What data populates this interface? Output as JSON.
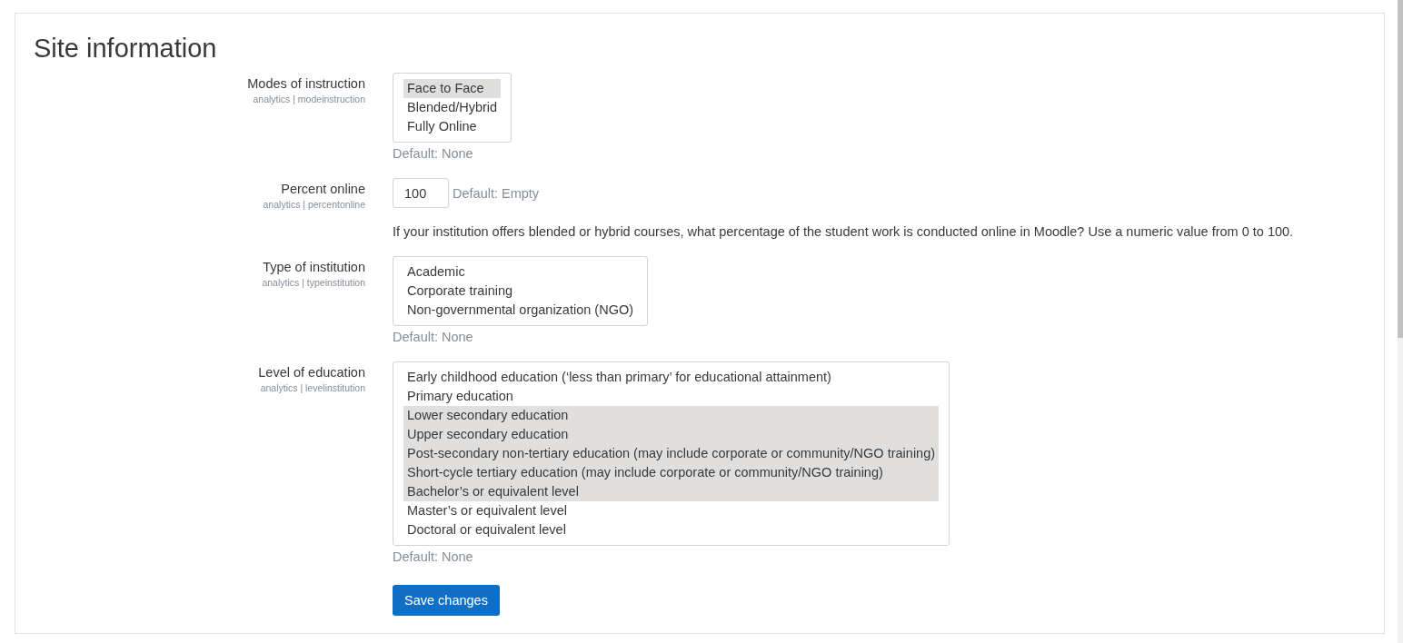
{
  "page": {
    "title": "Site information"
  },
  "settings": [
    {
      "kind": "multiselect",
      "label": "Modes of instruction",
      "key": "analytics | modeinstruction",
      "options": [
        {
          "label": "Face to Face",
          "selected": true
        },
        {
          "label": "Blended/Hybrid",
          "selected": false
        },
        {
          "label": "Fully Online",
          "selected": false
        }
      ],
      "default": "Default: None"
    },
    {
      "kind": "text",
      "label": "Percent online",
      "key": "analytics | percentonline",
      "value": "100",
      "default": "Default: Empty",
      "description": "If your institution offers blended or hybrid courses, what percentage of the student work is conducted online in Moodle? Use a numeric value from 0 to 100."
    },
    {
      "kind": "multiselect",
      "label": "Type of institution",
      "key": "analytics | typeinstitution",
      "options": [
        {
          "label": "Academic",
          "selected": false
        },
        {
          "label": "Corporate training",
          "selected": false
        },
        {
          "label": "Non-governmental organization (NGO)",
          "selected": false
        }
      ],
      "default": "Default: None"
    },
    {
      "kind": "multiselect",
      "label": "Level of education",
      "key": "analytics | levelinstitution",
      "options": [
        {
          "label": "Early childhood education (‘less than primary’ for educational attainment)",
          "selected": false
        },
        {
          "label": "Primary education",
          "selected": false
        },
        {
          "label": "Lower secondary education",
          "selected": true
        },
        {
          "label": "Upper secondary education",
          "selected": true
        },
        {
          "label": "Post-secondary non-tertiary education (may include corporate or community/NGO training)",
          "selected": true
        },
        {
          "label": "Short-cycle tertiary education (may include corporate or community/NGO training)",
          "selected": true
        },
        {
          "label": "Bachelor’s or equivalent level",
          "selected": true
        },
        {
          "label": "Master’s or equivalent level",
          "selected": false
        },
        {
          "label": "Doctoral or equivalent level",
          "selected": false
        }
      ],
      "default": "Default: None"
    }
  ],
  "save_button": "Save changes"
}
